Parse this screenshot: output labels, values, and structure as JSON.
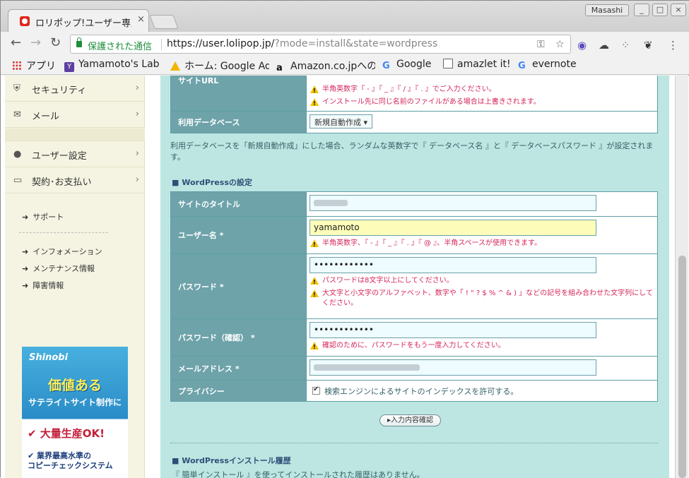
{
  "browser": {
    "tab_title": "ロリポップ!ユーザー専用ページ",
    "tab_close": "×",
    "profile_name": "Masashi",
    "win_minimize": "_",
    "win_maximize": "□",
    "win_close": "×",
    "secure_label": "保護された通信",
    "url_main": "https://user.lolipop.jp/",
    "url_query": "?mode=install&state=wordpress",
    "bookmarks": [
      {
        "label": "アプリ",
        "icon": "apps-grid-icon"
      },
      {
        "label": "Yamamoto's Lab",
        "icon": "yamamoto-lab-icon"
      },
      {
        "label": "ホーム: Google AdSense",
        "icon": "adsense-icon"
      },
      {
        "label": "Amazon.co.jpへのアク",
        "icon": "amazon-icon"
      },
      {
        "label": "Google",
        "icon": "google-icon"
      },
      {
        "label": "amazlet it!",
        "icon": "doc-icon"
      },
      {
        "label": "evernote",
        "icon": "google-icon"
      }
    ]
  },
  "sidebar": {
    "menu": [
      {
        "label": "セキュリティ",
        "icon": "shield-icon"
      },
      {
        "label": "メール",
        "icon": "mail-icon"
      },
      {
        "label": "ユーザー設定",
        "icon": "user-icon"
      },
      {
        "label": "契約･お支払い",
        "icon": "card-icon"
      }
    ],
    "links_top": [
      "サポート"
    ],
    "links_bottom": [
      "インフォメーション",
      "メンテナンス情報",
      "障害情報"
    ],
    "banner": {
      "logo": "Shinobi",
      "headline": "価値ある",
      "subline": "サテライトサイト制作に",
      "point1": "大量生産OK!",
      "point2_line1": "業界最高水準の",
      "point2_line2": "コピーチェックシステム"
    }
  },
  "form_top": {
    "site_url_label": "サイトURL",
    "site_url_warn1": "半角英数字『 - 』『 _ 』『 / 』『 . 』でご入力ください。",
    "site_url_warn2": "インストール先に同じ名前のファイルがある場合は上書きされます。",
    "db_label": "利用データベース",
    "db_select": "新規自動作成 ▾",
    "db_note": "利用データベースを「新規自動作成」にした場合、ランダムな英数字で『 データベース名 』と『 データベースパスワード 』が設定されます。"
  },
  "wordpress": {
    "section_title": "■ WordPressの設定",
    "site_title_label": "サイトのタイトル",
    "username_label": "ユーザー名 *",
    "username_value": "yamamoto",
    "username_warn": "半角英数字、『 - 』『 _ 』『 . 』『 @ 』、半角スペースが使用できます。",
    "password_label": "パスワード *",
    "password_value": "••••••••••••",
    "password_warn1": "パスワードは8文字以上にしてください。",
    "password_warn2": "大文字と小文字のアルファベット、数字や「 ! \" ? $ % ^ & ) 」などの記号を組み合わせた文字列にしてください。",
    "password_confirm_label": "パスワード（確認） *",
    "password_confirm_value": "••••••••••••",
    "password_confirm_warn": "確認のために、パスワードをもう一度入力してください。",
    "email_label": "メールアドレス *",
    "privacy_label": "プライバシー",
    "privacy_checkbox_label": "検索エンジンによるサイトのインデックスを許可する。",
    "confirm_button": "▸入力内容確認"
  },
  "history": {
    "section_title": "■ WordPressインストール履歴",
    "text": "『 簡単インストール 』を使ってインストールされた履歴はありません。"
  }
}
